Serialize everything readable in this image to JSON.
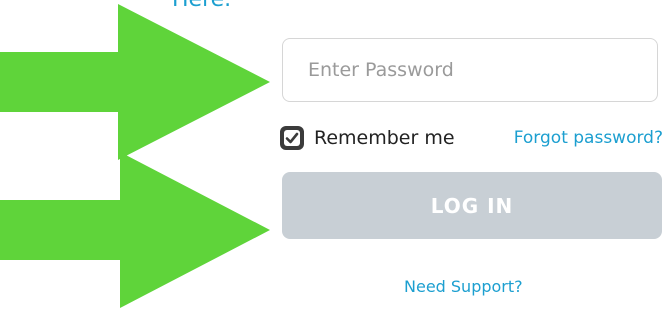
{
  "header": {
    "partial_link_text": "Here."
  },
  "form": {
    "password_placeholder": "Enter Password",
    "remember_label": "Remember me",
    "remember_checked": true,
    "forgot_label": "Forgot password?",
    "login_label": "LOG IN",
    "support_label": "Need Support?"
  },
  "colors": {
    "link": "#1c9fd0",
    "button_disabled": "#c8cfd5",
    "arrow": "#5fd43a",
    "checkbox": "#3b3b3b"
  },
  "annotations": {
    "arrows": [
      "arrow-right",
      "arrow-right"
    ]
  }
}
